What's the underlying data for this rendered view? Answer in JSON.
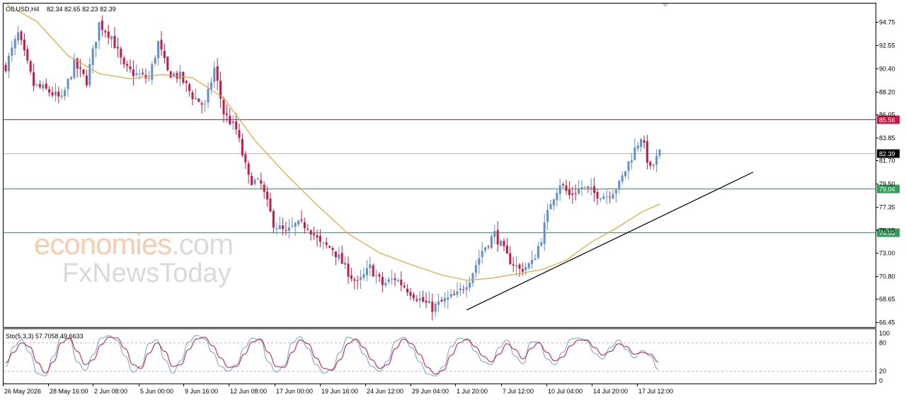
{
  "header": {
    "symbol_label": "OILUSD,H4",
    "ohlc": "82.34 82.65 82.23 82.39"
  },
  "watermark": {
    "brand": "economies",
    "domain": ".com",
    "sub": "FxNewsToday"
  },
  "chart_data": {
    "type": "candlestick",
    "y_ticks": [
      "94.75",
      "92.55",
      "90.40",
      "88.20",
      "86.05",
      "83.85",
      "81.70",
      "79.50",
      "77.35",
      "75.15",
      "73.00",
      "70.80",
      "68.65",
      "66.45"
    ],
    "ylim": [
      66.0,
      96.5
    ],
    "x_ticks": [
      "26 May 2026",
      "28 May 16:00",
      "2 Jun 08:00",
      "5 Jun 00:00",
      "9 Jun 16:00",
      "12 Jun 08:00",
      "17 Jun 00:00",
      "19 Jun 16:00",
      "24 Jun 12:00",
      "29 Jun 04:00",
      "1 Jul 20:00",
      "7 Jul 12:00",
      "10 Jul 04:00",
      "14 Jul 20:00",
      "17 Jul 12:00"
    ],
    "levels": [
      {
        "value": 85.56,
        "label": "85.56",
        "color": "#d0163f"
      },
      {
        "value": 82.39,
        "label": "82.39",
        "color": "#000000"
      },
      {
        "value": 79.04,
        "label": "79.04",
        "color": "#2e9e58"
      },
      {
        "value": 74.93,
        "label": "74.93",
        "color": "#2e9e58"
      }
    ],
    "colors": {
      "up": "#5b8fd6",
      "down": "#d0163f",
      "ma": "#e8a33a",
      "trend": "#000000"
    },
    "anchors": [
      [
        0,
        90.6
      ],
      [
        4,
        93.6
      ],
      [
        9,
        88.8
      ],
      [
        14,
        88.2
      ],
      [
        18,
        87.4
      ],
      [
        22,
        90.8
      ],
      [
        26,
        89.2
      ],
      [
        30,
        94.6
      ],
      [
        34,
        93.4
      ],
      [
        38,
        90.4
      ],
      [
        42,
        89.8
      ],
      [
        46,
        89.4
      ],
      [
        49,
        92.8
      ],
      [
        52,
        90.0
      ],
      [
        56,
        89.6
      ],
      [
        60,
        87.8
      ],
      [
        64,
        86.8
      ],
      [
        67,
        90.4
      ],
      [
        70,
        86.2
      ],
      [
        74,
        84.6
      ],
      [
        78,
        80.0
      ],
      [
        82,
        79.4
      ],
      [
        86,
        75.8
      ],
      [
        90,
        74.8
      ],
      [
        93,
        75.6
      ],
      [
        97,
        75.6
      ],
      [
        101,
        73.8
      ],
      [
        105,
        73.4
      ],
      [
        109,
        71.6
      ],
      [
        113,
        70.0
      ],
      [
        117,
        71.6
      ],
      [
        121,
        70.0
      ],
      [
        125,
        70.6
      ],
      [
        129,
        69.6
      ],
      [
        133,
        68.6
      ],
      [
        137,
        67.8
      ],
      [
        141,
        68.5
      ],
      [
        145,
        69.0
      ],
      [
        149,
        70.6
      ],
      [
        153,
        73.2
      ],
      [
        157,
        74.8
      ],
      [
        161,
        72.6
      ],
      [
        165,
        71.4
      ],
      [
        169,
        72.0
      ],
      [
        172,
        74.4
      ],
      [
        175,
        77.8
      ],
      [
        178,
        79.6
      ],
      [
        181,
        78.4
      ],
      [
        185,
        79.2
      ],
      [
        189,
        78.6
      ],
      [
        193,
        78.4
      ],
      [
        197,
        79.4
      ],
      [
        200,
        81.5
      ],
      [
        204,
        84.0
      ],
      [
        207,
        80.8
      ],
      [
        210,
        82.4
      ]
    ],
    "ma_points": [
      [
        0,
        96.8
      ],
      [
        10,
        94.8
      ],
      [
        20,
        91.6
      ],
      [
        30,
        89.9
      ],
      [
        40,
        89.4
      ],
      [
        50,
        89.8
      ],
      [
        60,
        89.5
      ],
      [
        70,
        87.6
      ],
      [
        80,
        83.6
      ],
      [
        90,
        80.4
      ],
      [
        100,
        77.5
      ],
      [
        110,
        74.8
      ],
      [
        120,
        73.0
      ],
      [
        130,
        71.9
      ],
      [
        140,
        70.9
      ],
      [
        148,
        70.4
      ],
      [
        156,
        70.6
      ],
      [
        164,
        71.0
      ],
      [
        172,
        71.4
      ],
      [
        180,
        72.3
      ],
      [
        188,
        74.0
      ],
      [
        196,
        75.3
      ],
      [
        204,
        76.8
      ],
      [
        210,
        77.6
      ]
    ],
    "trendline": {
      "x0": 148,
      "y0": 67.6,
      "x1": 240,
      "y1": 80.6
    },
    "stoch": {
      "label": "Sto(5,3,3) 57.7058 49.6633",
      "y_ticks": [
        "100",
        "80",
        "20",
        "0"
      ],
      "levels": [
        80,
        20
      ],
      "main": [
        30,
        72,
        86,
        60,
        15,
        10,
        52,
        92,
        88,
        40,
        22,
        55,
        90,
        95,
        85,
        52,
        18,
        30,
        78,
        86,
        44,
        16,
        42,
        82,
        96,
        88,
        60,
        30,
        20,
        34,
        70,
        90,
        86,
        40,
        18,
        32,
        80,
        93,
        68,
        34,
        16,
        24,
        60,
        92,
        86,
        56,
        30,
        20,
        42,
        84,
        92,
        70,
        40,
        14,
        10,
        30,
        72,
        90,
        86,
        62,
        40,
        34,
        70,
        86,
        52,
        36,
        82,
        82,
        46,
        34,
        60,
        88,
        90,
        84,
        58,
        46,
        70,
        86,
        66,
        48,
        64,
        52,
        24
      ],
      "signal": [
        38,
        60,
        80,
        72,
        38,
        16,
        40,
        80,
        90,
        62,
        34,
        44,
        76,
        92,
        90,
        68,
        34,
        26,
        58,
        80,
        62,
        30,
        34,
        66,
        88,
        92,
        74,
        48,
        28,
        30,
        56,
        82,
        88,
        60,
        30,
        28,
        60,
        86,
        78,
        48,
        26,
        22,
        44,
        78,
        88,
        70,
        44,
        26,
        34,
        68,
        88,
        78,
        56,
        28,
        14,
        22,
        54,
        80,
        88,
        72,
        52,
        40,
        56,
        78,
        66,
        46,
        68,
        80,
        60,
        42,
        50,
        74,
        86,
        86,
        70,
        54,
        62,
        78,
        72,
        56,
        60,
        56,
        40
      ]
    }
  }
}
